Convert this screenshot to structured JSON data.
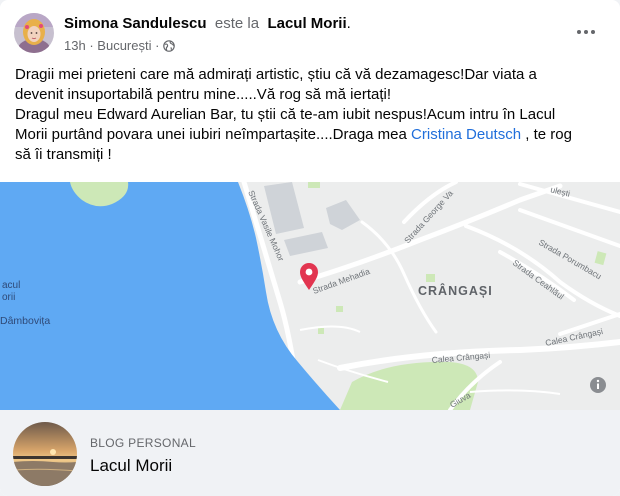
{
  "post": {
    "author": "Simona Sandulescu",
    "verb": "este la",
    "place": "Lacul Morii",
    "time": "13h",
    "location": "București",
    "separator": "·",
    "audience_icon": "globe-icon",
    "more_icon": "more-options-icon",
    "text_lines": [
      "Dragii mei prieteni care mă admirați artistic, știu că vă dezamagesc!Dar viata a",
      "devenit insuportabilă pentru mine.....Vă rog să mă iertați!",
      "Dragul meu Edward Aurelian Bar, tu știi că te-am iubit nespus!Acum intru în Lacul",
      "Morii purtând povara unei iubiri neîmpartașite....Draga mea "
    ],
    "mention": "Cristina Deutsch",
    "after_mention": " , te rog",
    "last_line": "să îi transmiți !"
  },
  "map": {
    "labels": {
      "lake_1": "acul",
      "lake_2": "orii",
      "river": "Dâmbovița",
      "district": "CRÂNGAȘI",
      "street_mehadia": "Strada Mehadia",
      "street_vasile_mohor": "Strada Vasile Mohor",
      "street_george_valentin": "Strada George Va",
      "street_porumbacu": "Strada Porumbacu",
      "street_ceahlaul": "Strada Ceahlăul",
      "calea_crangasi_1": "Calea Crângași",
      "calea_crangasi_2": "Calea Crângași",
      "street_fragment_top": "ulești",
      "street_fragment_bottom": "Giuva"
    },
    "info_icon": "info-icon",
    "pin_icon": "map-pin-icon",
    "colors": {
      "water": "#5fa9f3",
      "land": "#eceded",
      "park": "#cde8b7",
      "building": "#cfd3d8",
      "road": "#ffffff",
      "pin": "#e23550"
    }
  },
  "page": {
    "category": "BLOG PERSONAL",
    "name": "Lacul Morii"
  }
}
